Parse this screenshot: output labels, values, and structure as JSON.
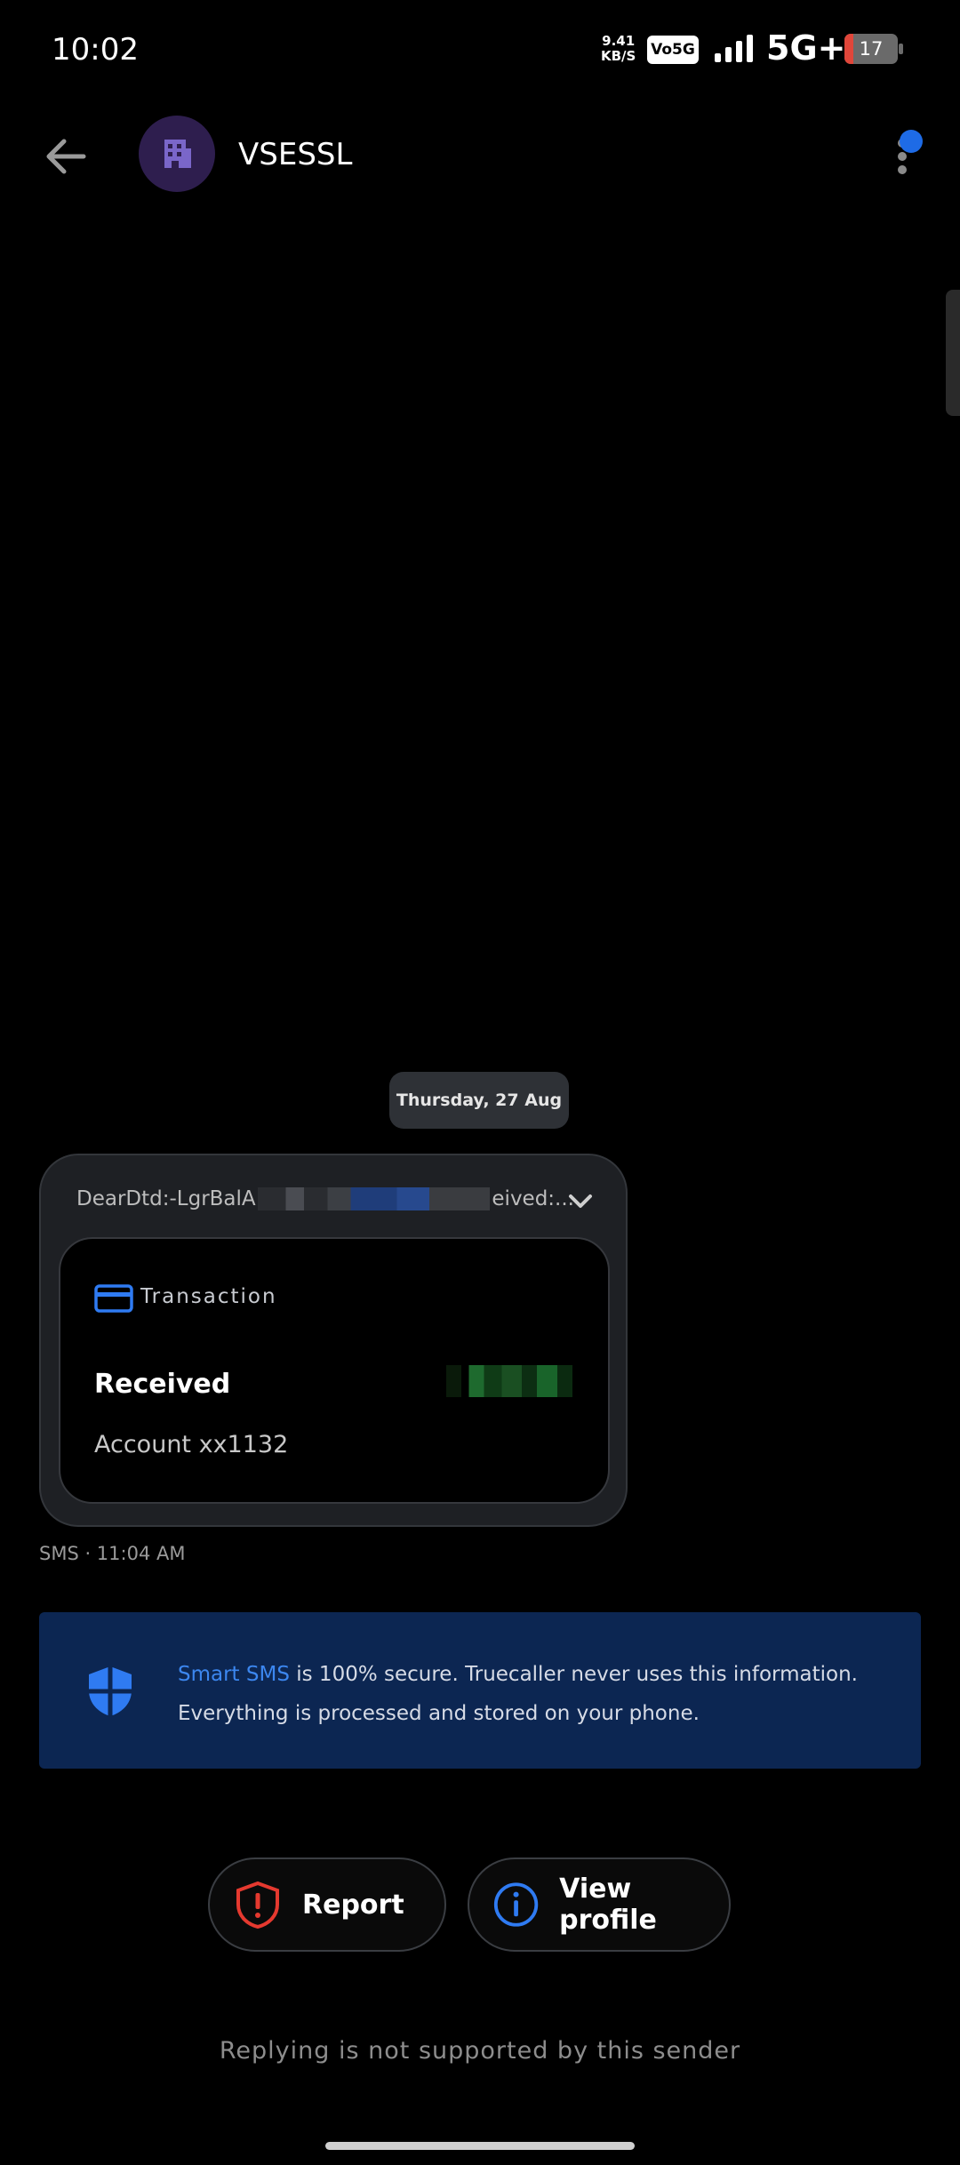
{
  "status_bar": {
    "time": "10:02",
    "net_speed_value": "9.41",
    "net_speed_unit": "KB/S",
    "volte": "Vo5G",
    "network": "5G+",
    "battery": "17",
    "battery_level": 0.17
  },
  "app_bar": {
    "title": "VSESSL",
    "menu_badge_color": "#1e6be6"
  },
  "conversation": {
    "date_chip": "Thursday, 27 Aug",
    "message": {
      "preview_start": "DearDtd:-LgrBalA",
      "preview_end": "eived:...",
      "card_type": "Transaction",
      "status": "Received",
      "account": "Account xx1132"
    },
    "meta": "SMS · 11:04 AM"
  },
  "info_banner": {
    "highlight": "Smart SMS",
    "text_rest": " is 100% secure. Truecaller never uses this information.",
    "text_line2": "Everything is processed and stored on your phone."
  },
  "actions": {
    "report": "Report",
    "view_profile": "View profile"
  },
  "footer": {
    "reply_note": "Replying is not supported by this sender"
  },
  "colors": {
    "accent": "#3c87f0",
    "report_red": "#e5392f",
    "banner_bg": "#0c2652"
  }
}
